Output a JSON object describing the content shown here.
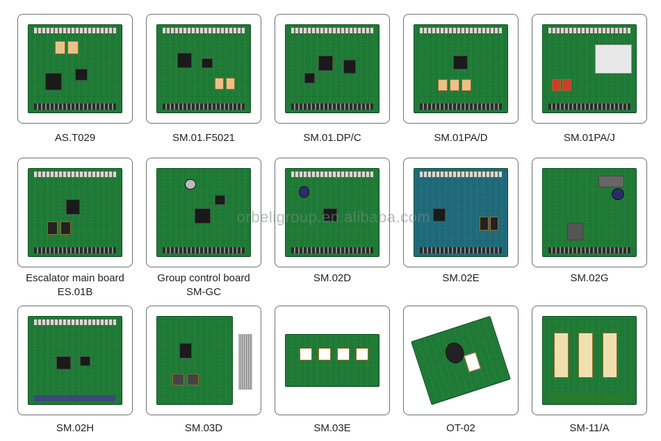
{
  "watermark": "orbeligroup.en.alibaba.com",
  "products": [
    {
      "line1": "AS.T029",
      "line2": ""
    },
    {
      "line1": "SM.01.F5021",
      "line2": ""
    },
    {
      "line1": "SM.01.DP/C",
      "line2": ""
    },
    {
      "line1": "SM.01PA/D",
      "line2": ""
    },
    {
      "line1": "SM.01PA/J",
      "line2": ""
    },
    {
      "line1": "Escalator main board",
      "line2": "ES.01B"
    },
    {
      "line1": "Group control board",
      "line2": "SM-GC"
    },
    {
      "line1": "SM.02D",
      "line2": ""
    },
    {
      "line1": "SM.02E",
      "line2": ""
    },
    {
      "line1": "SM.02G",
      "line2": ""
    },
    {
      "line1": "SM.02H",
      "line2": ""
    },
    {
      "line1": "SM.03D",
      "line2": ""
    },
    {
      "line1": "SM.03E",
      "line2": ""
    },
    {
      "line1": "OT-02",
      "line2": ""
    },
    {
      "line1": "SM-11/A",
      "line2": ""
    }
  ]
}
